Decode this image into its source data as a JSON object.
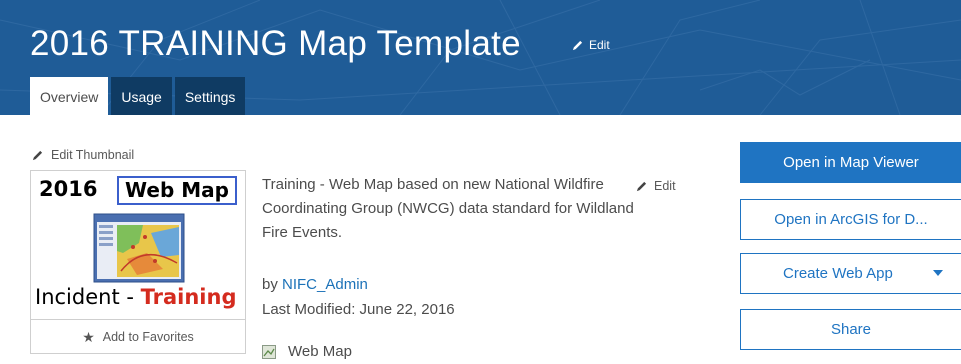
{
  "header": {
    "title": "2016 TRAINING Map Template",
    "edit_label": "Edit",
    "tabs": [
      {
        "label": "Overview",
        "active": true
      },
      {
        "label": "Usage",
        "active": false
      },
      {
        "label": "Settings",
        "active": false
      }
    ]
  },
  "thumbnail": {
    "edit_label": "Edit Thumbnail",
    "image_text": {
      "year": "2016",
      "webmap": "Web Map",
      "incident": "Incident - ",
      "training": "Training"
    },
    "favorites_label": "Add to Favorites"
  },
  "details": {
    "description": "Training - Web Map based on new National Wildfire Coordinating Group (NWCG) data standard for Wildland Fire Events.",
    "edit_label": "Edit",
    "by_prefix": "by ",
    "owner": "NIFC_Admin",
    "last_modified": "Last Modified: June 22, 2016",
    "item_type": "Web Map"
  },
  "actions": {
    "open_map_viewer": "Open in Map Viewer",
    "open_arcgis": "Open in ArcGIS for D...",
    "create_web_app": "Create Web App",
    "share": "Share"
  },
  "colors": {
    "banner": "#1f5c97",
    "tab_inactive": "#0f3b63",
    "primary": "#1f74c2",
    "training_red": "#d42b1e"
  },
  "icons": [
    "pencil-icon",
    "star-icon",
    "web-map-icon",
    "chevron-down-icon"
  ]
}
